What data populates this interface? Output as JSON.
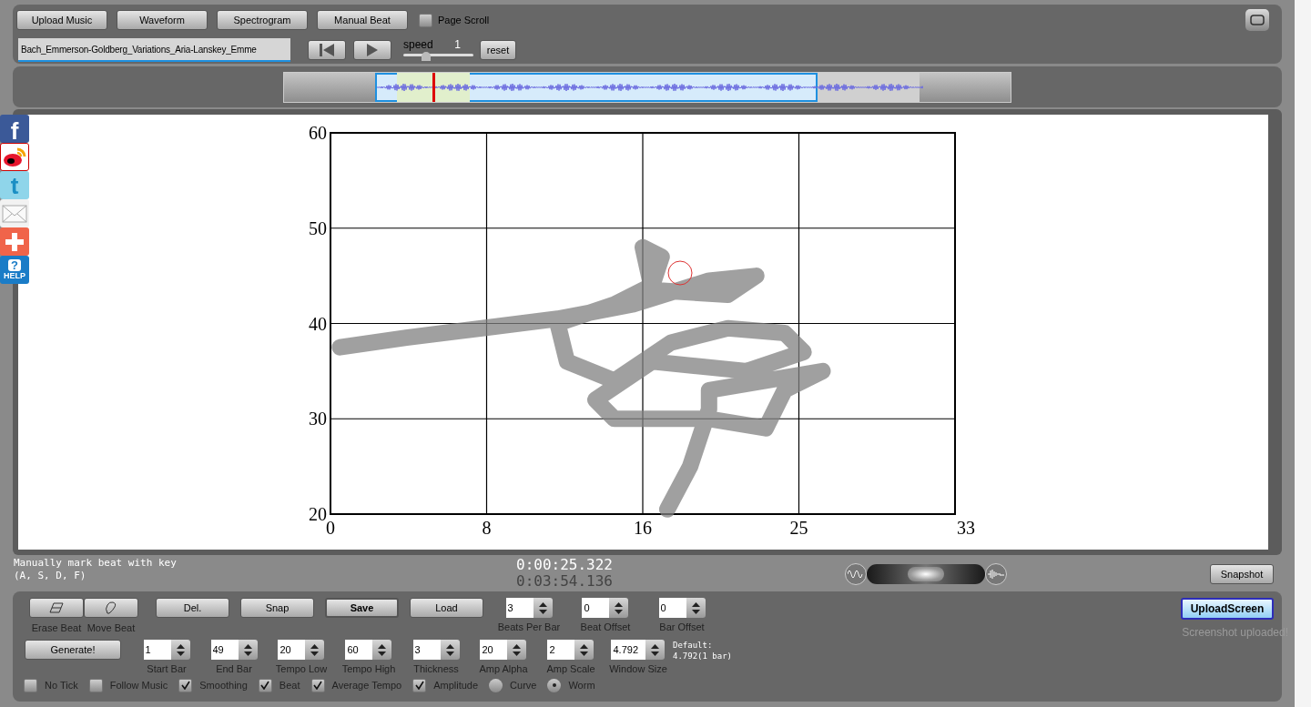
{
  "top_buttons": [
    "Upload Music",
    "Waveform",
    "Spectrogram",
    "Manual Beat"
  ],
  "page_scroll": {
    "label": "Page Scroll",
    "checked": false
  },
  "file_field": {
    "value": "Bach_Emmerson-Goldberg_Variations_Aria-Lanskey_Emme"
  },
  "speed": {
    "label": "speed",
    "value": "1",
    "level": 0.33
  },
  "reset_button": "reset",
  "share_icons": [
    {
      "kind": "facebook",
      "glyph": "f"
    },
    {
      "kind": "weibo"
    },
    {
      "kind": "twitter",
      "glyph": "t"
    },
    {
      "kind": "mail"
    },
    {
      "kind": "plus"
    },
    {
      "kind": "help",
      "glyph": "?",
      "caption": "HELP"
    }
  ],
  "plot": {
    "chart_data": {
      "type": "line",
      "grid": true,
      "xlim": [
        0,
        33
      ],
      "ylim": [
        20,
        60
      ],
      "xticks": [
        0,
        {
          "value": 8.25,
          "label": "8"
        },
        {
          "value": 16.5,
          "label": "16"
        },
        {
          "value": 24.75,
          "label": "25"
        },
        {
          "value": 33,
          "label": "33"
        }
      ],
      "yticks": [
        20,
        30,
        40,
        50,
        60
      ],
      "x": [
        0.5,
        4,
        8,
        12,
        16,
        20,
        22.5,
        21,
        17,
        16.5,
        17.5,
        17,
        15,
        12,
        12.5,
        15,
        18,
        21,
        24,
        25,
        22,
        17,
        14,
        15,
        20,
        23,
        24,
        26,
        20,
        20,
        19,
        17.8
      ],
      "series": [
        {
          "color": "#808080",
          "values": [
            37.5,
            38.5,
            39.5,
            40.5,
            42,
            44.5,
            45,
            43,
            43.5,
            48,
            47,
            44,
            42,
            40,
            36,
            34,
            38,
            39.5,
            39,
            37,
            35,
            36,
            32,
            30,
            30,
            29,
            33,
            35,
            33,
            31,
            25,
            20.5
          ]
        }
      ]
    }
  },
  "blend_slider": {
    "level": 0.5
  },
  "status_note": [
    "Manually mark beat with key",
    "(A, S, D, F)"
  ],
  "times": [
    "0:00:25.322",
    "0:03:54.136"
  ],
  "snapshot_button": "Snapshot",
  "tool_buttons": [
    {
      "kind": "erase",
      "caption": "Erase Beat"
    },
    {
      "kind": "move",
      "caption": "Move Beat"
    }
  ],
  "action_buttons": [
    {
      "label": "Del.",
      "focused": false
    },
    {
      "label": "Snap",
      "focused": false
    },
    {
      "label": "Save",
      "focused": true
    },
    {
      "label": "Load",
      "focused": false
    }
  ],
  "beat_fields": [
    {
      "label": "Beats Per Bar",
      "value": "3"
    },
    {
      "label": "Beat Offset",
      "value": "0"
    },
    {
      "label": "Bar Offset",
      "value": "0"
    }
  ],
  "generate_button": "Generate!",
  "param_fields": [
    {
      "label": "Start Bar",
      "value": "1"
    },
    {
      "label": "End Bar",
      "value": "49"
    },
    {
      "label": "Tempo Low",
      "value": "20"
    },
    {
      "label": "Tempo High",
      "value": "60"
    },
    {
      "label": "Thickness",
      "value": "3"
    },
    {
      "label": "Amp Alpha",
      "value": "20"
    },
    {
      "label": "Amp Scale",
      "value": "2"
    },
    {
      "label": "Window Size",
      "value": "4.792"
    }
  ],
  "default_note": [
    "Default:",
    "4.792(1 bar)"
  ],
  "options": [
    {
      "kind": "checkbox",
      "label": "No Tick",
      "checked": false
    },
    {
      "kind": "checkbox",
      "label": "Follow Music",
      "checked": false
    },
    {
      "kind": "checkbox",
      "label": "Smoothing",
      "checked": true
    },
    {
      "kind": "checkbox",
      "label": "Beat",
      "checked": true
    },
    {
      "kind": "checkbox",
      "label": "Average Tempo",
      "checked": true
    },
    {
      "kind": "checkbox",
      "label": "Amplitude",
      "checked": true
    },
    {
      "kind": "radio",
      "label": "Curve",
      "selected": false
    },
    {
      "kind": "radio",
      "label": "Worm",
      "selected": true
    }
  ],
  "upload_button": {
    "label": "UploadScreen",
    "focused": true
  },
  "upload_status": "Screenshot uploaded!"
}
